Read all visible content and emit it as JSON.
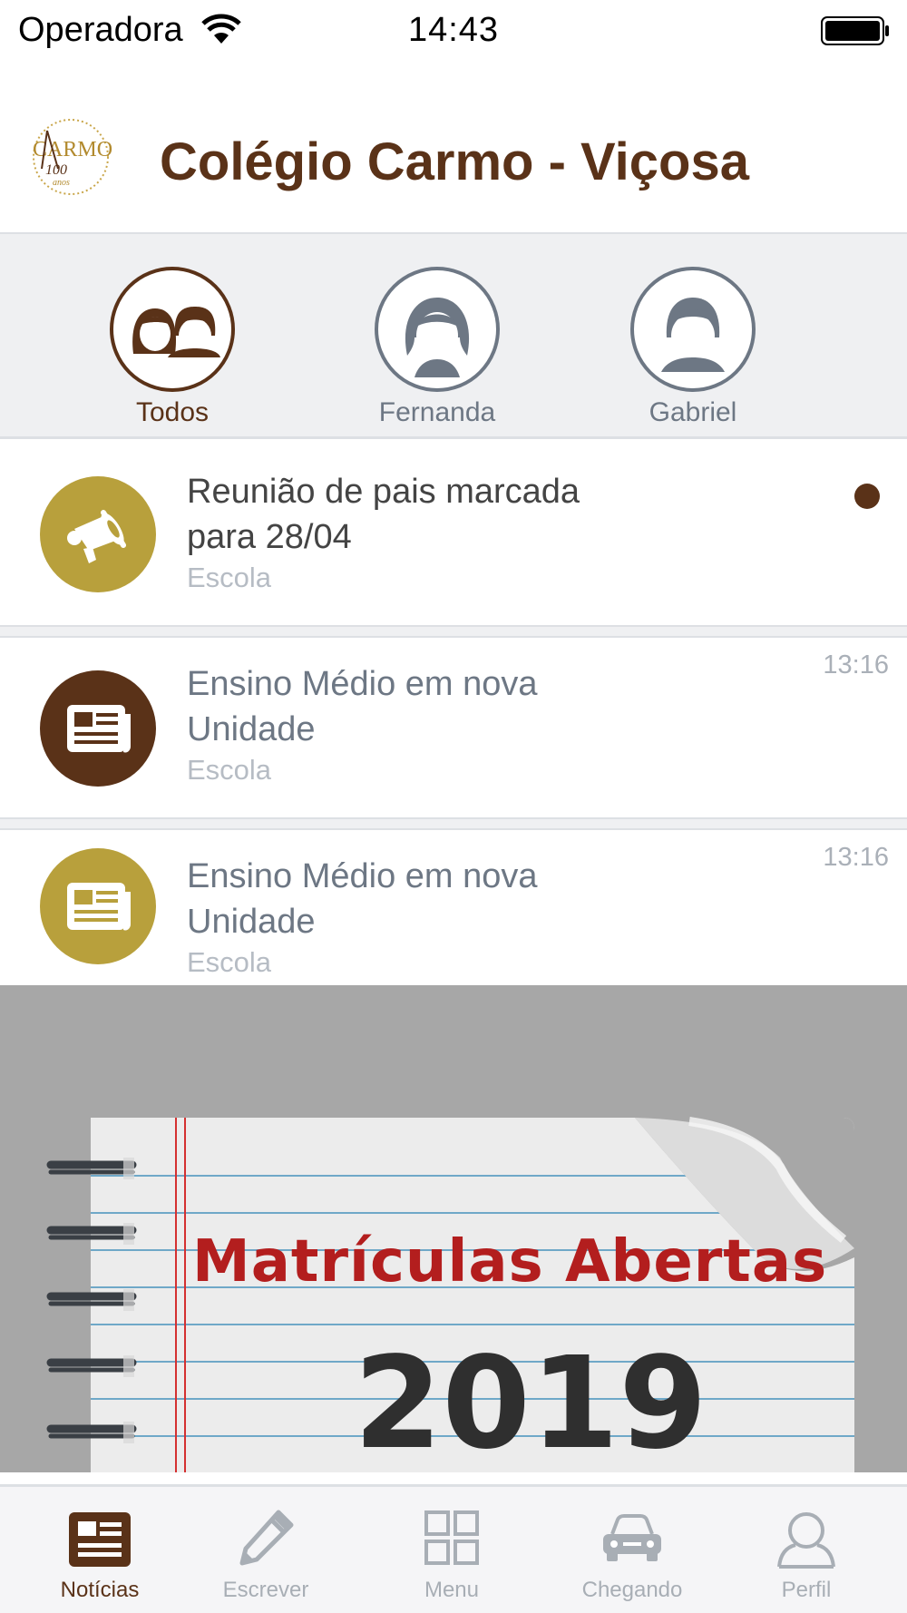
{
  "status_bar": {
    "carrier": "Operadora",
    "time": "14:43"
  },
  "header": {
    "title": "Colégio Carmo - Viçosa",
    "logo_icon": "carmo-100-anos-logo"
  },
  "profiles": [
    {
      "label": "Todos",
      "icon": "two-children-icon",
      "selected": true
    },
    {
      "label": "Fernanda",
      "icon": "girl-avatar-icon",
      "selected": false
    },
    {
      "label": "Gabriel",
      "icon": "boy-avatar-icon",
      "selected": false
    }
  ],
  "feed": [
    {
      "title_line1": "Reunião de pais marcada",
      "title_line2": "para 28/04",
      "source": "Escola",
      "time": "",
      "unread": true,
      "icon": "megaphone-icon",
      "icon_color": "#b8a03c"
    },
    {
      "title_line1": "Ensino Médio em nova",
      "title_line2": "Unidade",
      "source": "Escola",
      "time": "13:16",
      "unread": false,
      "icon": "newspaper-icon",
      "icon_color": "#5a3218"
    },
    {
      "title_line1": "Ensino Médio em nova",
      "title_line2": "Unidade",
      "source": "Escola",
      "time": "13:16",
      "unread": false,
      "icon": "newspaper-icon",
      "icon_color": "#b8a03c"
    }
  ],
  "banner": {
    "title": "Matrículas Abertas",
    "year": "2019"
  },
  "tabs": [
    {
      "label": "Notícias",
      "icon": "newspaper-icon",
      "active": true
    },
    {
      "label": "Escrever",
      "icon": "pencil-icon",
      "active": false
    },
    {
      "label": "Menu",
      "icon": "grid-icon",
      "active": false
    },
    {
      "label": "Chegando",
      "icon": "car-icon",
      "active": false
    },
    {
      "label": "Perfil",
      "icon": "person-icon",
      "active": false
    }
  ],
  "colors": {
    "brand_brown": "#5a3218",
    "gold": "#b8a03c",
    "inactive_gray": "#6d7784",
    "banner_red": "#b31e1e"
  }
}
